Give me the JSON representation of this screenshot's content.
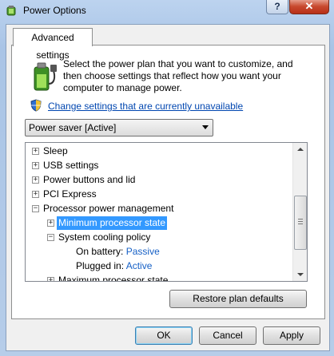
{
  "window": {
    "title": "Power Options",
    "help_label": "?",
    "close_label": "✕"
  },
  "tabs": [
    {
      "label": "Advanced settings"
    }
  ],
  "intro_text": "Select the power plan that you want to customize, and then choose settings that reflect how you want your computer to manage power.",
  "change_link": "Change settings that are currently unavailable",
  "plan_select": {
    "selected": "Power saver [Active]"
  },
  "tree": [
    {
      "label": "Sleep",
      "expander": "+",
      "level": 0
    },
    {
      "label": "USB settings",
      "expander": "+",
      "level": 0
    },
    {
      "label": "Power buttons and lid",
      "expander": "+",
      "level": 0
    },
    {
      "label": "PCI Express",
      "expander": "+",
      "level": 0
    },
    {
      "label": "Processor power management",
      "expander": "−",
      "level": 0
    },
    {
      "label": "Minimum processor state",
      "expander": "+",
      "level": 1,
      "selected": true
    },
    {
      "label": "System cooling policy",
      "expander": "−",
      "level": 1
    },
    {
      "label": "On battery:",
      "value": "Passive",
      "level": 2
    },
    {
      "label": "Plugged in:",
      "value": "Active",
      "level": 2
    },
    {
      "label": "Maximum processor state",
      "expander": "+",
      "level": 1
    }
  ],
  "buttons": {
    "restore": "Restore plan defaults",
    "ok": "OK",
    "cancel": "Cancel",
    "apply": "Apply"
  },
  "colors": {
    "link": "#0046b0",
    "selection": "#3399ff",
    "value": "#1660c6"
  },
  "icons": {
    "app": "power-options-icon",
    "battery": "battery-plug-icon",
    "shield": "uac-shield-icon"
  }
}
